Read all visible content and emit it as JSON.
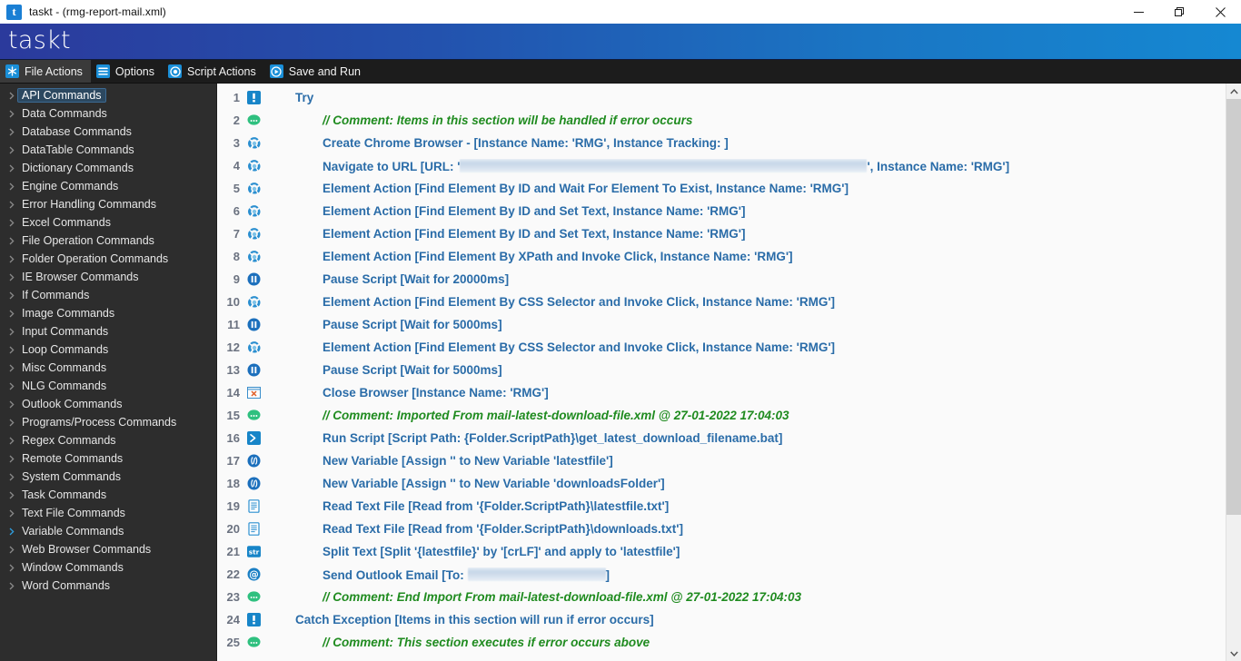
{
  "window": {
    "icon_letter": "t",
    "title": "taskt - (rmg-report-mail.xml)",
    "minimize_label": "Minimize",
    "restore_label": "Restore",
    "close_label": "Close"
  },
  "brand": {
    "name": "taskt"
  },
  "toolbar": {
    "items": [
      {
        "label": "File Actions",
        "icon": "asterisk-icon",
        "active": true
      },
      {
        "label": "Options",
        "icon": "hamburger-icon",
        "active": false
      },
      {
        "label": "Script Actions",
        "icon": "record-circle-icon",
        "active": false
      },
      {
        "label": "Save and Run",
        "icon": "play-circle-icon",
        "active": false
      }
    ]
  },
  "sidebar": {
    "items": [
      {
        "label": "API Commands",
        "selected": true,
        "expanded": false
      },
      {
        "label": "Data Commands",
        "selected": false,
        "expanded": false
      },
      {
        "label": "Database Commands",
        "selected": false,
        "expanded": false
      },
      {
        "label": "DataTable Commands",
        "selected": false,
        "expanded": false
      },
      {
        "label": "Dictionary Commands",
        "selected": false,
        "expanded": false
      },
      {
        "label": "Engine Commands",
        "selected": false,
        "expanded": false
      },
      {
        "label": "Error Handling Commands",
        "selected": false,
        "expanded": false
      },
      {
        "label": "Excel Commands",
        "selected": false,
        "expanded": false
      },
      {
        "label": "File Operation Commands",
        "selected": false,
        "expanded": false
      },
      {
        "label": "Folder Operation Commands",
        "selected": false,
        "expanded": false
      },
      {
        "label": "IE Browser Commands",
        "selected": false,
        "expanded": false
      },
      {
        "label": "If Commands",
        "selected": false,
        "expanded": false
      },
      {
        "label": "Image Commands",
        "selected": false,
        "expanded": false
      },
      {
        "label": "Input Commands",
        "selected": false,
        "expanded": false
      },
      {
        "label": "Loop Commands",
        "selected": false,
        "expanded": false
      },
      {
        "label": "Misc Commands",
        "selected": false,
        "expanded": false
      },
      {
        "label": "NLG Commands",
        "selected": false,
        "expanded": false
      },
      {
        "label": "Outlook Commands",
        "selected": false,
        "expanded": false
      },
      {
        "label": "Programs/Process Commands",
        "selected": false,
        "expanded": false
      },
      {
        "label": "Regex Commands",
        "selected": false,
        "expanded": false
      },
      {
        "label": "Remote Commands",
        "selected": false,
        "expanded": false
      },
      {
        "label": "System Commands",
        "selected": false,
        "expanded": false
      },
      {
        "label": "Task Commands",
        "selected": false,
        "expanded": false
      },
      {
        "label": "Text File Commands",
        "selected": false,
        "expanded": false
      },
      {
        "label": "Variable Commands",
        "selected": false,
        "expanded": true
      },
      {
        "label": "Web Browser Commands",
        "selected": false,
        "expanded": false
      },
      {
        "label": "Window Commands",
        "selected": false,
        "expanded": false
      },
      {
        "label": "Word Commands",
        "selected": false,
        "expanded": false
      }
    ]
  },
  "script": {
    "rows": [
      {
        "num": "1",
        "icon": "exception-block-icon",
        "indent": 0,
        "kind": "command",
        "text": "Try"
      },
      {
        "num": "2",
        "icon": "comment-icon",
        "indent": 1,
        "kind": "comment",
        "text": "// Comment: Items in this section will be handled if error occurs"
      },
      {
        "num": "3",
        "icon": "chrome-icon",
        "indent": 1,
        "kind": "command",
        "text": "Create Chrome Browser - [Instance Name: 'RMG', Instance Tracking: ]"
      },
      {
        "num": "4",
        "icon": "chrome-icon",
        "indent": 1,
        "kind": "command",
        "text": "Navigate to URL [URL: '",
        "redacted": "url",
        "text_after": "', Instance Name: 'RMG']"
      },
      {
        "num": "5",
        "icon": "chrome-icon",
        "indent": 1,
        "kind": "command",
        "text": "Element Action [Find Element By ID and Wait For Element To Exist, Instance Name: 'RMG']"
      },
      {
        "num": "6",
        "icon": "chrome-icon",
        "indent": 1,
        "kind": "command",
        "text": "Element Action [Find Element By ID and Set Text, Instance Name: 'RMG']"
      },
      {
        "num": "7",
        "icon": "chrome-icon",
        "indent": 1,
        "kind": "command",
        "text": "Element Action [Find Element By ID and Set Text, Instance Name: 'RMG']"
      },
      {
        "num": "8",
        "icon": "chrome-icon",
        "indent": 1,
        "kind": "command",
        "text": "Element Action [Find Element By XPath and Invoke Click, Instance Name: 'RMG']"
      },
      {
        "num": "9",
        "icon": "pause-icon",
        "indent": 1,
        "kind": "command",
        "text": "Pause Script [Wait for 20000ms]"
      },
      {
        "num": "10",
        "icon": "chrome-icon",
        "indent": 1,
        "kind": "command",
        "text": "Element Action [Find Element By CSS Selector and Invoke Click, Instance Name: 'RMG']"
      },
      {
        "num": "11",
        "icon": "pause-icon",
        "indent": 1,
        "kind": "command",
        "text": "Pause Script [Wait for 5000ms]"
      },
      {
        "num": "12",
        "icon": "chrome-icon",
        "indent": 1,
        "kind": "command",
        "text": "Element Action [Find Element By CSS Selector and Invoke Click, Instance Name: 'RMG']"
      },
      {
        "num": "13",
        "icon": "pause-icon",
        "indent": 1,
        "kind": "command",
        "text": "Pause Script [Wait for 5000ms]"
      },
      {
        "num": "14",
        "icon": "close-window-icon",
        "indent": 1,
        "kind": "command",
        "text": "Close Browser [Instance Name: 'RMG']"
      },
      {
        "num": "15",
        "icon": "comment-icon",
        "indent": 1,
        "kind": "comment",
        "text": "// Comment: Imported From mail-latest-download-file.xml @ 27-01-2022 17:04:03"
      },
      {
        "num": "16",
        "icon": "console-icon",
        "indent": 1,
        "kind": "command",
        "text": "Run Script [Script Path: {Folder.ScriptPath}\\get_latest_download_filename.bat]"
      },
      {
        "num": "17",
        "icon": "variable-icon",
        "indent": 1,
        "kind": "command",
        "text": "New Variable [Assign '' to New Variable 'latestfile']"
      },
      {
        "num": "18",
        "icon": "variable-icon",
        "indent": 1,
        "kind": "command",
        "text": "New Variable [Assign '' to New Variable 'downloadsFolder']"
      },
      {
        "num": "19",
        "icon": "textfile-icon",
        "indent": 1,
        "kind": "command",
        "text": "Read Text File [Read from '{Folder.ScriptPath}\\latestfile.txt']"
      },
      {
        "num": "20",
        "icon": "textfile-icon",
        "indent": 1,
        "kind": "command",
        "text": "Read Text File [Read from '{Folder.ScriptPath}\\downloads.txt']"
      },
      {
        "num": "21",
        "icon": "string-icon",
        "indent": 1,
        "kind": "command",
        "text": "Split Text [Split '{latestfile}' by '[crLF]' and apply to 'latestfile']"
      },
      {
        "num": "22",
        "icon": "email-icon",
        "indent": 1,
        "kind": "command",
        "text": "Send Outlook Email [To: ",
        "redacted": "mail",
        "text_after": "]"
      },
      {
        "num": "23",
        "icon": "comment-icon",
        "indent": 1,
        "kind": "comment",
        "text": "// Comment: End Import From mail-latest-download-file.xml @ 27-01-2022 17:04:03"
      },
      {
        "num": "24",
        "icon": "exception-block-icon",
        "indent": 0,
        "kind": "command",
        "text": "Catch Exception [Items in this section will run if error occurs]"
      },
      {
        "num": "25",
        "icon": "comment-icon",
        "indent": 1,
        "kind": "comment",
        "text": "// Comment: This section executes if error occurs above"
      }
    ]
  },
  "scrollbar": {
    "up_label": "Scroll up",
    "down_label": "Scroll down",
    "thumb_label": "Vertical scroll thumb"
  },
  "colors": {
    "brand_start": "#2b3a9c",
    "brand_end": "#1588d2",
    "accent_blue": "#1a8fd8",
    "command_text": "#2a6ca8",
    "comment_text": "#1f8b1f",
    "sidebar_bg": "#2d2d2d",
    "panel_bg": "#fafafa"
  }
}
